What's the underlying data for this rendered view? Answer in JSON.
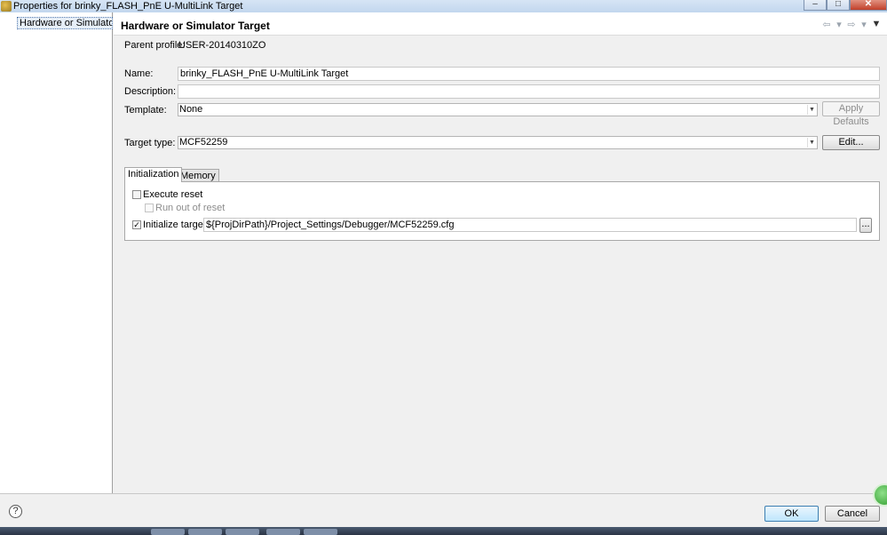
{
  "window": {
    "title": "Properties for brinky_FLASH_PnE U-MultiLink Target",
    "controls": {
      "minimize": "–",
      "maximize": "□",
      "close": "✕"
    }
  },
  "tree": {
    "items": [
      {
        "label": "Hardware or Simulator Ta",
        "selected": true
      }
    ]
  },
  "page": {
    "title": "Hardware or Simulator Target",
    "nav_icons": [
      "back-arrow-icon",
      "forward-arrow-icon",
      "menu-dropdown-icon"
    ]
  },
  "form": {
    "parent_profile_label": "Parent profile:",
    "parent_profile_value": "USER-20140310ZO",
    "name_label": "Name:",
    "name_value": "brinky_FLASH_PnE U-MultiLink Target",
    "description_label": "Description:",
    "description_value": "",
    "template_label": "Template:",
    "template_value": "None",
    "apply_defaults_label": "Apply Defaults",
    "target_type_label": "Target type:",
    "target_type_value": "MCF52259",
    "edit_label": "Edit..."
  },
  "tabs": [
    {
      "label": "Initialization",
      "active": true
    },
    {
      "label": "Memory",
      "active": false
    }
  ],
  "initialization": {
    "execute_reset_label": "Execute reset",
    "execute_reset_checked": false,
    "run_out_of_reset_label": "Run out of reset",
    "run_out_of_reset_checked": false,
    "run_out_of_reset_enabled": false,
    "initialize_target_label": "Initialize target:",
    "initialize_target_checked": true,
    "initialize_target_path": "${ProjDirPath}/Project_Settings/Debugger/MCF52259.cfg",
    "browse_label": "..."
  },
  "footer": {
    "help_label": "?",
    "ok_label": "OK",
    "cancel_label": "Cancel"
  },
  "colors": {
    "titlebar": "#c8daef",
    "primary_button_border": "#3c7fb1",
    "close_button": "#c0402a"
  }
}
